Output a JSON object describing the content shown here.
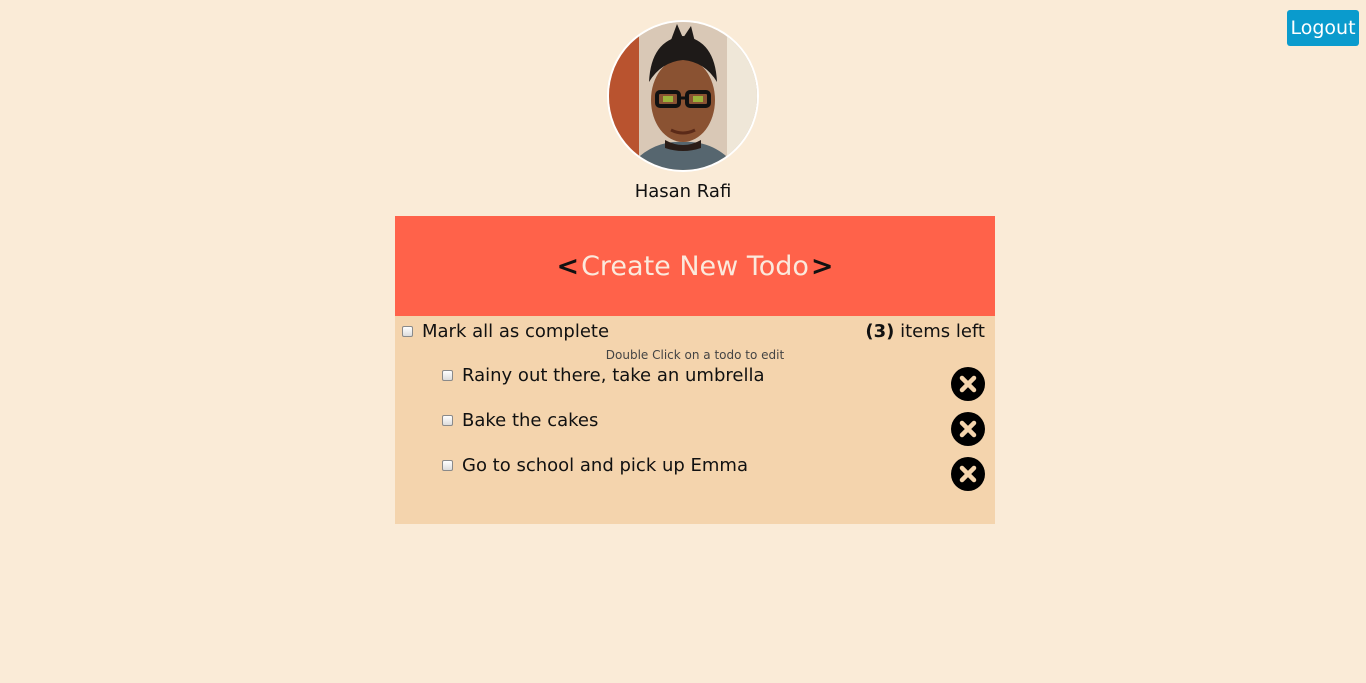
{
  "header": {
    "logout_label": "Logout"
  },
  "profile": {
    "name": "Hasan Rafi",
    "avatar_icon": "user-photo"
  },
  "create": {
    "open_bracket": "<",
    "label": "Create New Todo",
    "close_bracket": ">",
    "background": "#ff624a"
  },
  "controls": {
    "mark_all_label": "Mark all as complete",
    "items_left_count": "(3)",
    "items_left_label": " items left",
    "hint": "Double Click on a todo to edit"
  },
  "todos": [
    {
      "text": "Rainy out there, take an umbrella",
      "completed": false
    },
    {
      "text": "Bake the cakes",
      "completed": false
    },
    {
      "text": "Go to school and pick up Emma",
      "completed": false
    }
  ],
  "colors": {
    "page_bg": "#faebd7",
    "panel_bg": "#f4d4ad",
    "logout_bg": "#0a9bcd"
  }
}
